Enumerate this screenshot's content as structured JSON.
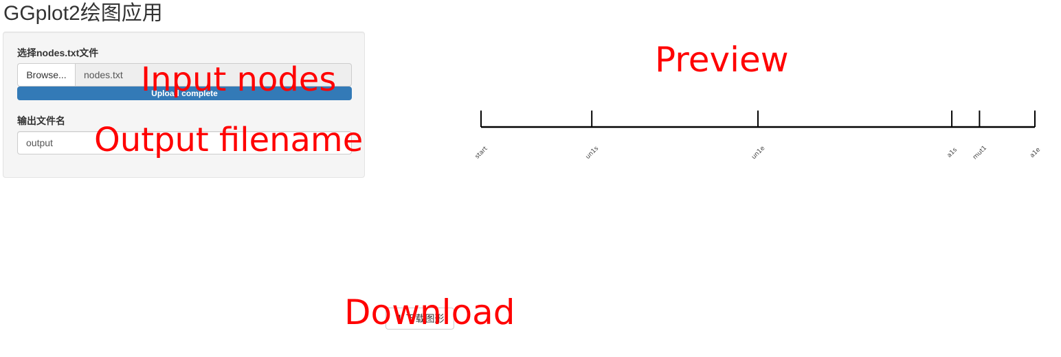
{
  "app": {
    "title": "GGplot2绘图应用"
  },
  "sidebar": {
    "file_input": {
      "label": "选择nodes.txt文件",
      "browse_label": "Browse...",
      "file_name": "nodes.txt",
      "progress_text": "Upload complete",
      "progress": 1.0
    },
    "output_input": {
      "label": "输出文件名",
      "value": "output"
    }
  },
  "plot": {
    "tick_labels": [
      "start",
      "un1s",
      "un1e",
      "a1s",
      "mut1",
      "a1e"
    ],
    "positions": [
      0,
      20,
      50,
      85,
      90,
      100
    ],
    "xlim": [
      0,
      100
    ]
  },
  "download": {
    "label": "下载图形",
    "icon": "download-icon"
  },
  "annotations": {
    "input_nodes": "Input nodes",
    "output_filename": "Output filename",
    "preview": "Preview",
    "download": "Download"
  },
  "colors": {
    "annotation": "#ff0000",
    "progress": "#337ab7"
  }
}
